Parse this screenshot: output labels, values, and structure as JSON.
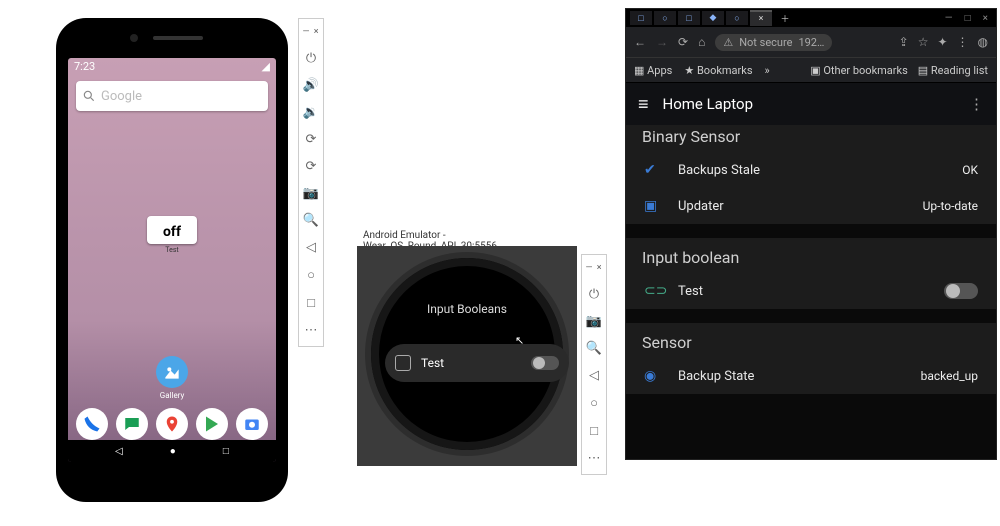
{
  "phone": {
    "clock": "7:23",
    "search_placeholder": "Google",
    "widget": {
      "state": "off",
      "label": "Test"
    },
    "gallery_label": "Gallery",
    "nav": {
      "back": "◁",
      "home": "●",
      "recent": "□"
    }
  },
  "phone_panel": {
    "hdr": "— ×",
    "items": [
      "⏻",
      "🔊",
      "🔉",
      "⟳",
      "⟳",
      "📷",
      "🔍",
      "◁",
      "○",
      "□",
      "⋯"
    ]
  },
  "wear": {
    "titlebar": "Android Emulator - Wear_OS_Round_API_30:5556",
    "screen_title": "Input Booleans",
    "row_label": "Test"
  },
  "wear_panel": {
    "hdr": "— ×",
    "items": [
      "⏻",
      "📷",
      "🔍",
      "◁",
      "○",
      "□",
      "⋯"
    ]
  },
  "browser": {
    "tabs": [
      "□",
      "○",
      "□",
      "◆",
      "○"
    ],
    "active_tab": "×",
    "addr": {
      "warn": "⚠",
      "secure_text": "Not secure",
      "url": "192…"
    },
    "bookmarks": {
      "apps": "Apps",
      "bm": "Bookmarks",
      "other": "Other bookmarks",
      "read": "Reading list"
    },
    "ha_title": "Home Laptop",
    "sec_binary": "Binary Sensor",
    "rows_binary": [
      {
        "label": "Backups Stale",
        "value": "OK"
      },
      {
        "label": "Updater",
        "value": "Up-to-date"
      }
    ],
    "sec_input": "Input boolean",
    "row_input": {
      "label": "Test"
    },
    "sec_sensor": "Sensor",
    "row_sensor": {
      "label": "Backup State",
      "value": "backed_up"
    }
  }
}
